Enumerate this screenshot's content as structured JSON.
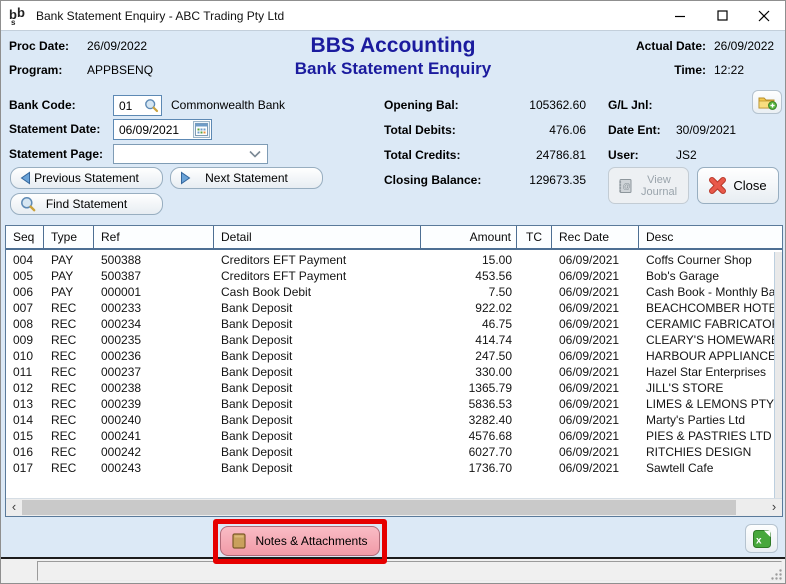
{
  "colors": {
    "client_bg": "#dce9f6",
    "accent_navy": "#1b1b9e",
    "highlight_red": "#e60000",
    "notes_button_pink": "#f4a7b2",
    "excel_green": "#47a83c",
    "table_line_blue": "#4d6f93"
  },
  "window": {
    "title": "Bank Statement Enquiry - ABC Trading Pty Ltd"
  },
  "header": {
    "proc_date_label": "Proc Date:",
    "proc_date": "26/09/2022",
    "program_label": "Program:",
    "program": "APPBSENQ",
    "app_title": "BBS Accounting",
    "screen_title": "Bank Statement Enquiry",
    "actual_date_label": "Actual Date:",
    "actual_date": "26/09/2022",
    "time_label": "Time:",
    "time": "12:22"
  },
  "form": {
    "bank_code_label": "Bank Code:",
    "bank_code": "01",
    "bank_name": "Commonwealth Bank",
    "statement_date_label": "Statement Date:",
    "statement_date": "06/09/2021",
    "statement_page_label": "Statement Page:",
    "statement_page": "",
    "previous_statement_label": "Previous Statement",
    "next_statement_label": "Next Statement",
    "find_statement_label": "Find Statement"
  },
  "summary": {
    "opening_bal_label": "Opening Bal:",
    "opening_bal": "105362.60",
    "total_debits_label": "Total Debits:",
    "total_debits": "476.06",
    "total_credits_label": "Total Credits:",
    "total_credits": "24786.81",
    "closing_balance_label": "Closing Balance:",
    "closing_balance": "129673.35"
  },
  "journal": {
    "gl_jnl_label": "G/L Jnl:",
    "gl_jnl": "",
    "date_ent_label": "Date Ent:",
    "date_ent": "30/09/2021",
    "user_label": "User:",
    "user": "JS2",
    "view_journal_label": "View Journal",
    "close_label": "Close"
  },
  "table": {
    "columns": [
      "Seq",
      "Type",
      "Ref",
      "Detail",
      "Amount",
      "TC",
      "Rec Date",
      "Desc"
    ],
    "rows": [
      [
        "004",
        "PAY",
        "500388",
        "Creditors EFT Payment",
        "15.00",
        "",
        "06/09/2021",
        "Coffs Courner Shop"
      ],
      [
        "005",
        "PAY",
        "500387",
        "Creditors EFT Payment",
        "453.56",
        "",
        "06/09/2021",
        "Bob's Garage"
      ],
      [
        "006",
        "PAY",
        "000001",
        "Cash Book Debit",
        "7.50",
        "",
        "06/09/2021",
        "Cash Book - Monthly Bank"
      ],
      [
        "007",
        "REC",
        "000233",
        "Bank Deposit",
        "922.02",
        "",
        "06/09/2021",
        "BEACHCOMBER HOTEL"
      ],
      [
        "008",
        "REC",
        "000234",
        "Bank Deposit",
        "46.75",
        "",
        "06/09/2021",
        "CERAMIC FABRICATORS"
      ],
      [
        "009",
        "REC",
        "000235",
        "Bank Deposit",
        "414.74",
        "",
        "06/09/2021",
        "CLEARY'S HOMEWARES"
      ],
      [
        "010",
        "REC",
        "000236",
        "Bank Deposit",
        "247.50",
        "",
        "06/09/2021",
        "HARBOUR APPLIANCES"
      ],
      [
        "011",
        "REC",
        "000237",
        "Bank Deposit",
        "330.00",
        "",
        "06/09/2021",
        "Hazel Star Enterprises"
      ],
      [
        "012",
        "REC",
        "000238",
        "Bank Deposit",
        "1365.79",
        "",
        "06/09/2021",
        "JILL'S STORE"
      ],
      [
        "013",
        "REC",
        "000239",
        "Bank Deposit",
        "5836.53",
        "",
        "06/09/2021",
        "LIMES & LEMONS PTY LTD"
      ],
      [
        "014",
        "REC",
        "000240",
        "Bank Deposit",
        "3282.40",
        "",
        "06/09/2021",
        "Marty's Parties Ltd"
      ],
      [
        "015",
        "REC",
        "000241",
        "Bank Deposit",
        "4576.68",
        "",
        "06/09/2021",
        "PIES & PASTRIES LTD"
      ],
      [
        "016",
        "REC",
        "000242",
        "Bank Deposit",
        "6027.70",
        "",
        "06/09/2021",
        "RITCHIES DESIGN"
      ],
      [
        "017",
        "REC",
        "000243",
        "Bank Deposit",
        "1736.70",
        "",
        "06/09/2021",
        "Sawtell Cafe"
      ]
    ]
  },
  "footer": {
    "notes_button_label": "Notes & Attachments"
  },
  "icons": {
    "scroll_left": "‹",
    "scroll_right": "›"
  }
}
